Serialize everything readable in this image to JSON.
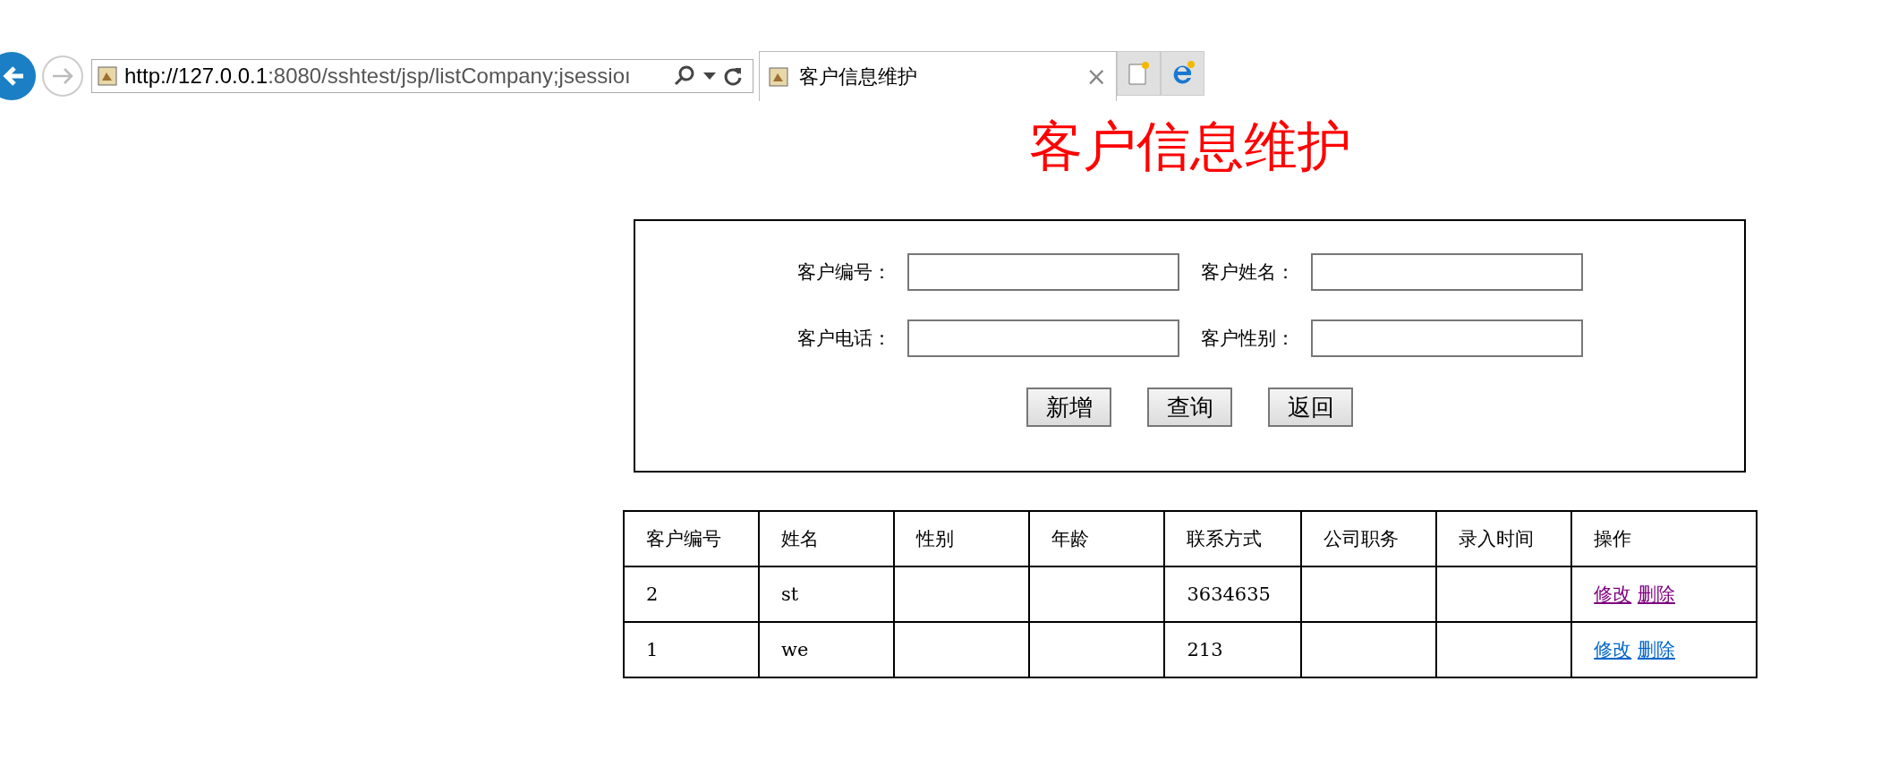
{
  "browser": {
    "url_host": "http://127.0.0.1",
    "url_rest": ":8080/sshtest/jsp/listCompany;jsessioı",
    "tab_title": "客户信息维护",
    "tab_close": "×"
  },
  "page_title": "客户信息维护",
  "search_form": {
    "fields": [
      {
        "label": "客户编号："
      },
      {
        "label": "客户姓名："
      },
      {
        "label": "客户电话："
      },
      {
        "label": "客户性别："
      }
    ],
    "buttons": [
      "新增",
      "查询",
      "返回"
    ]
  },
  "table": {
    "columns": [
      "客户编号",
      "姓名",
      "性别",
      "年龄",
      "联系方式",
      "公司职务",
      "录入时间",
      "操作"
    ],
    "rows": [
      {
        "cells": [
          "2",
          "st",
          null,
          null,
          "3634635",
          null,
          null
        ],
        "actions": [
          {
            "label": "修改",
            "visited": true
          },
          {
            "label": "删除",
            "visited": true
          }
        ]
      },
      {
        "cells": [
          "1",
          "we",
          null,
          null,
          "213",
          null,
          null
        ],
        "actions": [
          {
            "label": "修改",
            "visited": false
          },
          {
            "label": "删除",
            "visited": false
          }
        ]
      }
    ]
  }
}
